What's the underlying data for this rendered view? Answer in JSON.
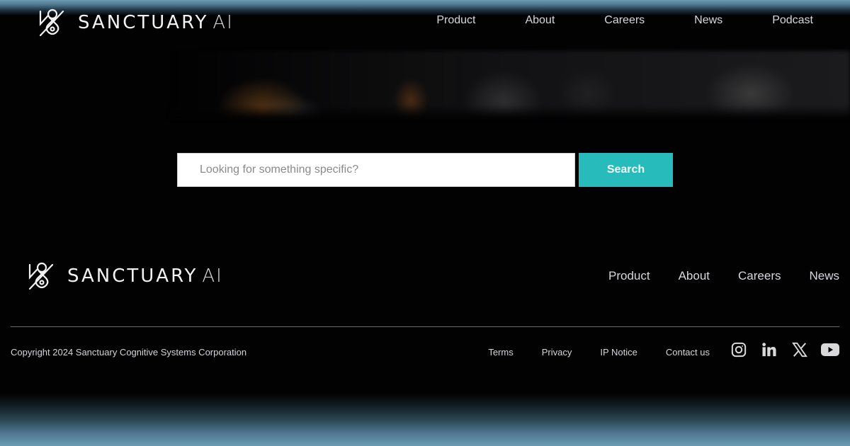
{
  "brand": {
    "name": "SANCTUARY",
    "suffix": "AI"
  },
  "header": {
    "nav": [
      "Product",
      "About",
      "Careers",
      "News",
      "Podcast"
    ]
  },
  "search": {
    "placeholder": "Looking for something specific?",
    "value": "",
    "button_label": "Search",
    "button_color": "#27bbbb"
  },
  "footer": {
    "nav": [
      "Product",
      "About",
      "Careers",
      "News"
    ],
    "copyright": "Copyright 2024 Sanctuary Cognitive Systems Corporation",
    "legal_links": [
      "Terms",
      "Privacy",
      "IP Notice",
      "Contact us"
    ],
    "social": [
      {
        "icon": "instagram-icon"
      },
      {
        "icon": "linkedin-icon"
      },
      {
        "icon": "x-icon"
      },
      {
        "icon": "youtube-icon"
      }
    ]
  }
}
